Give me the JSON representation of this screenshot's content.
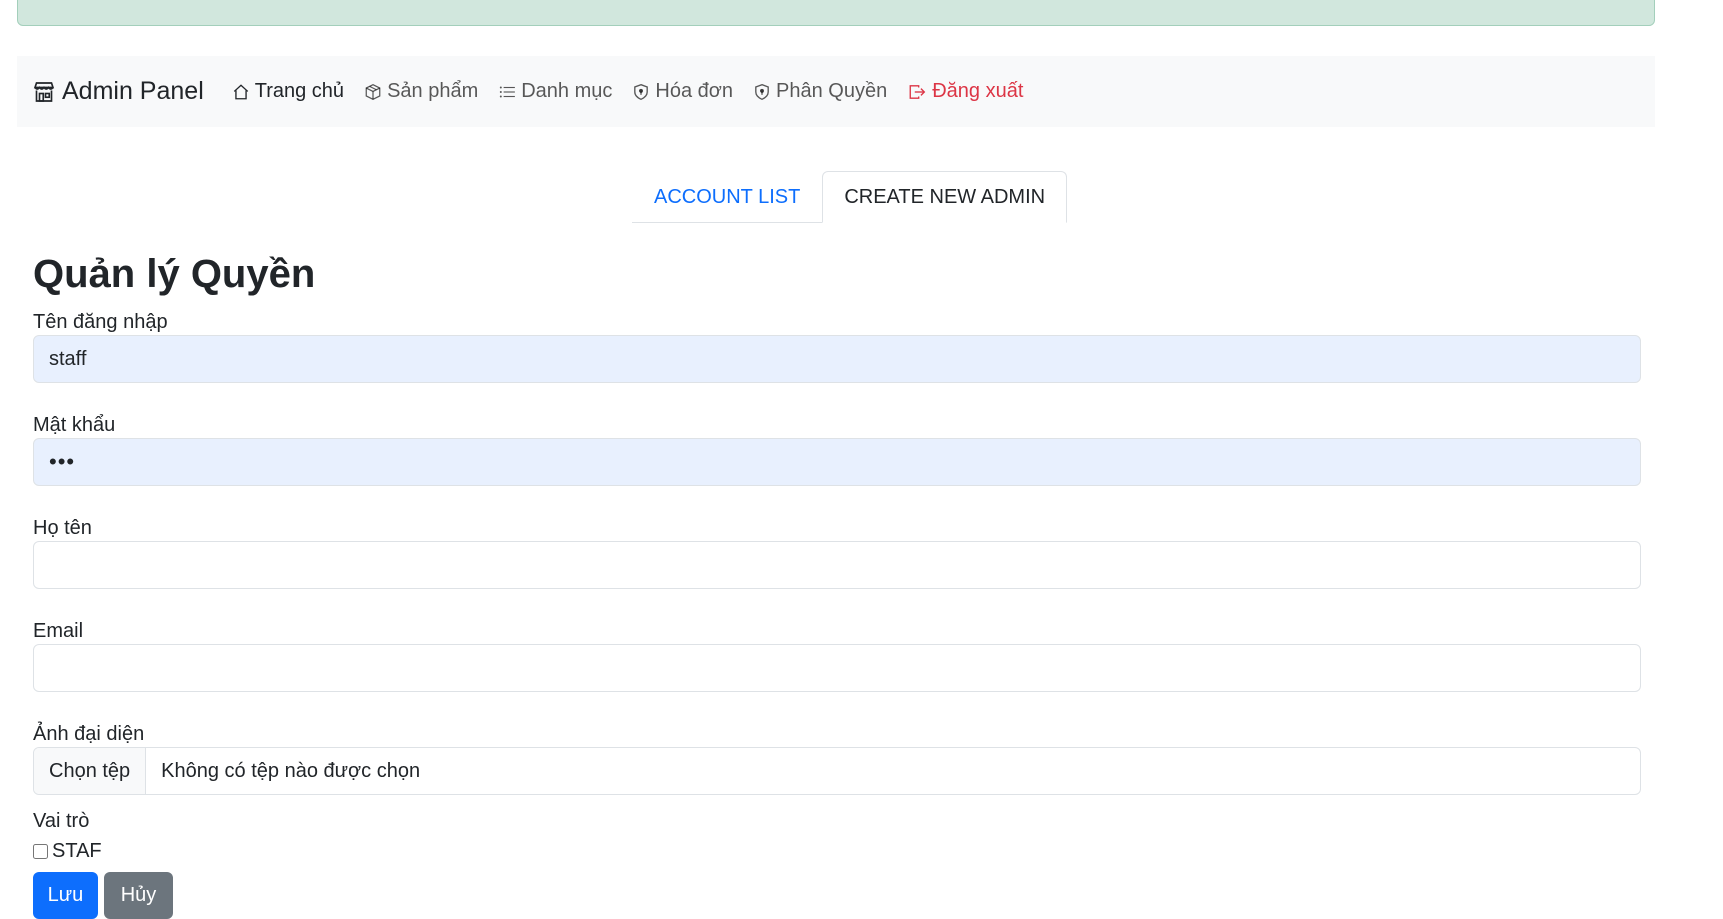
{
  "navbar": {
    "brand": "Admin Panel",
    "links": [
      {
        "label": "Trang chủ",
        "icon": "house-icon"
      },
      {
        "label": "Sản phẩm",
        "icon": "box-icon"
      },
      {
        "label": "Danh mục",
        "icon": "list-icon"
      },
      {
        "label": "Hóa đơn",
        "icon": "shield-icon"
      },
      {
        "label": "Phân Quyền",
        "icon": "shield-icon"
      },
      {
        "label": "Đăng xuất",
        "icon": "logout-icon"
      }
    ]
  },
  "tabs": [
    {
      "label": "ACCOUNT LIST",
      "active": false
    },
    {
      "label": "CREATE NEW ADMIN",
      "active": true
    }
  ],
  "page": {
    "title": "Quản lý Quyền"
  },
  "form": {
    "username": {
      "label": "Tên đăng nhập",
      "value": "staff"
    },
    "password": {
      "label": "Mật khẩu",
      "value": "•••"
    },
    "fullname": {
      "label": "Họ tên",
      "value": ""
    },
    "email": {
      "label": "Email",
      "value": ""
    },
    "avatar": {
      "label": "Ảnh đại diện",
      "button": "Chọn tệp",
      "status": "Không có tệp nào được chọn"
    },
    "role": {
      "label": "Vai trò",
      "option": "STAF",
      "checked": false
    },
    "save": "Lưu",
    "cancel": "Hủy"
  },
  "colors": {
    "primary": "#0d6efd",
    "secondary": "#6c757d",
    "danger": "#dc3545",
    "success_bg": "#d1e7dd",
    "autofill_bg": "#e8f0fe"
  }
}
